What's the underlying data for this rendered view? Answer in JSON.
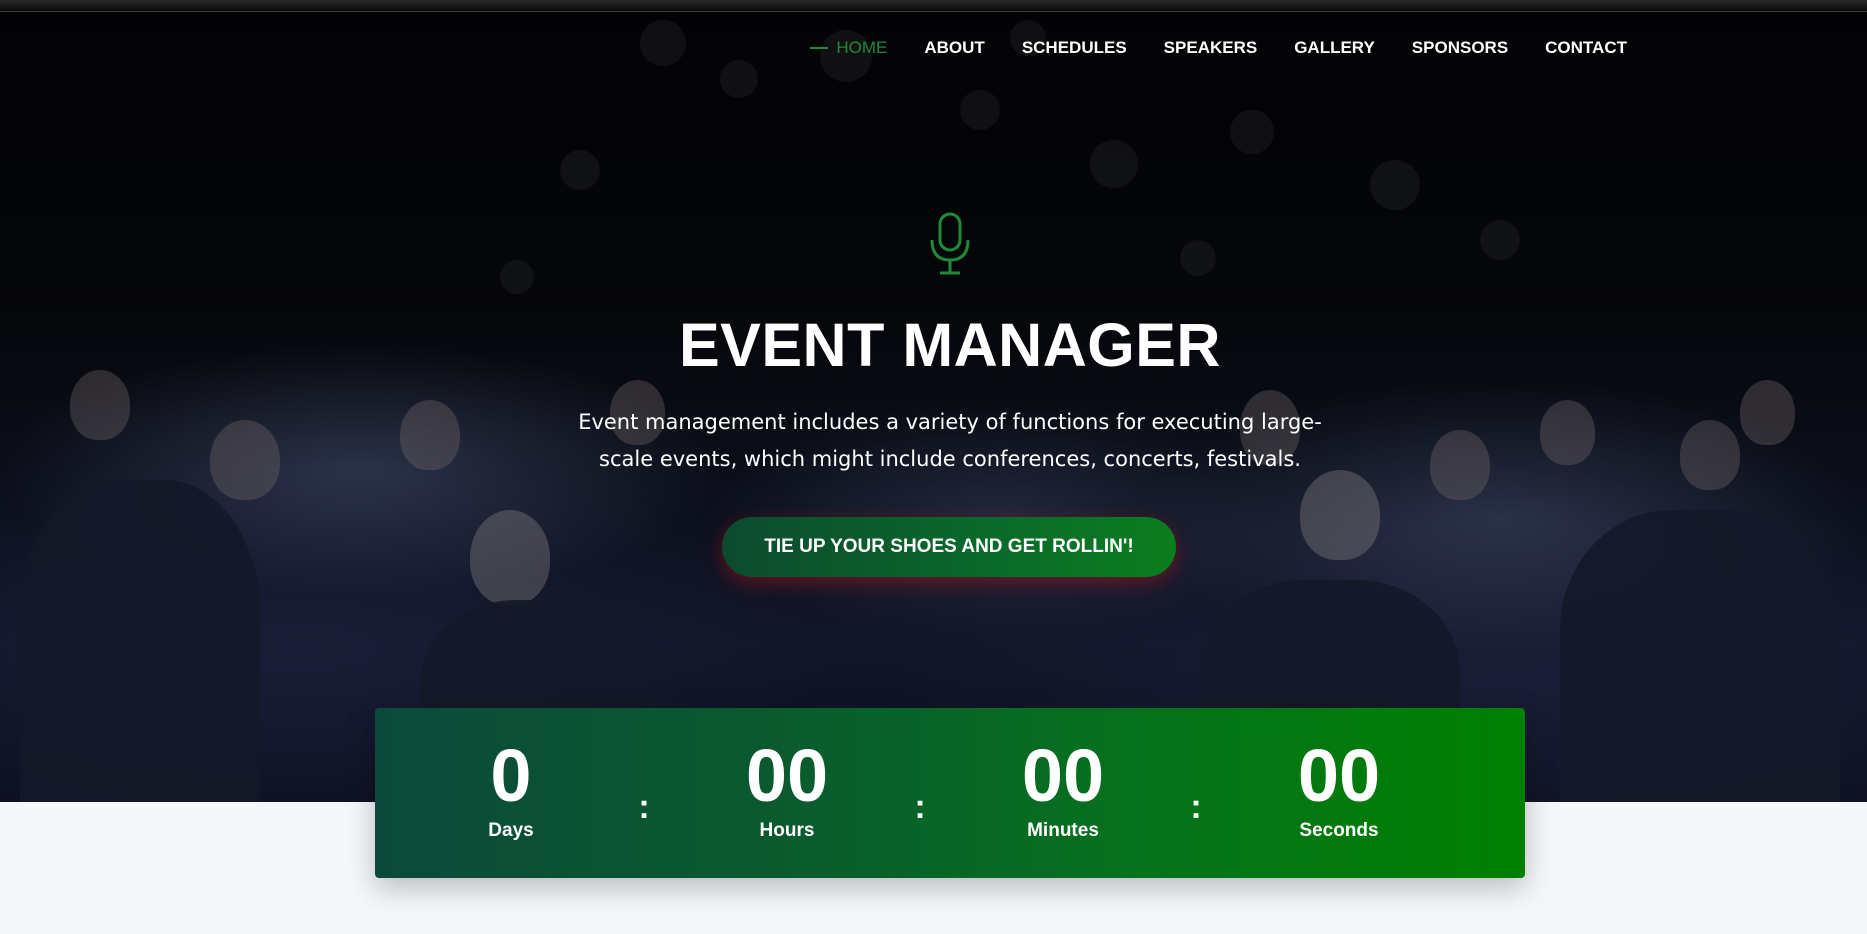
{
  "nav": {
    "items": [
      {
        "label": "HOME",
        "active": true
      },
      {
        "label": "ABOUT"
      },
      {
        "label": "SCHEDULES"
      },
      {
        "label": "SPEAKERS"
      },
      {
        "label": "GALLERY"
      },
      {
        "label": "SPONSORS"
      },
      {
        "label": "CONTACT"
      }
    ]
  },
  "hero": {
    "icon": "microphone-icon",
    "title": "EVENT MANAGER",
    "description": "Event management includes a variety of functions for executing large-scale events, which might include conferences, concerts, festivals.",
    "cta_label": "TIE UP YOUR SHOES AND GET ROLLIN'!"
  },
  "countdown": {
    "days": {
      "value": "0",
      "label": "Days"
    },
    "hours": {
      "value": "00",
      "label": "Hours"
    },
    "minutes": {
      "value": "00",
      "label": "Minutes"
    },
    "seconds": {
      "value": "00",
      "label": "Seconds"
    },
    "separator": ":"
  },
  "colors": {
    "accent_green": "#1f8a3a",
    "countdown_start": "#0b4a3a",
    "countdown_end": "#008000",
    "page_bg": "#f5f8fa"
  }
}
